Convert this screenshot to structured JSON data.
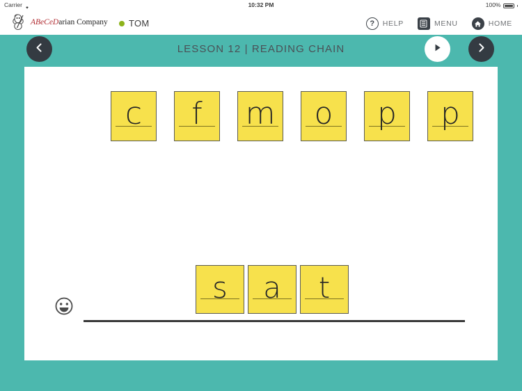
{
  "status_bar": {
    "carrier": "Carrier",
    "wifi_icon": "wifi-icon",
    "time": "10:32 PM",
    "battery_percent": "100%",
    "battery_icon": "battery-full-icon"
  },
  "header": {
    "logo_icon": "abecedarian-logo-icon",
    "brand_red": "ABeCeD",
    "brand_black": "arian Company",
    "user_name": "TOM",
    "user_status_color": "#8DB31B",
    "actions": [
      {
        "label": "HELP",
        "icon": "question-mark-icon"
      },
      {
        "label": "MENU",
        "icon": "menu-list-icon"
      },
      {
        "label": "HOME",
        "icon": "home-icon"
      }
    ]
  },
  "lesson_bar": {
    "title": "LESSON 12 | READING CHAIN",
    "prev_icon": "chevron-left-icon",
    "play_icon": "play-icon",
    "next_icon": "chevron-right-icon",
    "background_color": "#4CB8AE"
  },
  "activity": {
    "tile_color": "#F7E14C",
    "tile_border_color": "#5b5b52",
    "top_row": [
      "c",
      "f",
      "m",
      "o",
      "p",
      "p"
    ],
    "bottom_row": [
      "s",
      "a",
      "t"
    ],
    "smiley_icon": "smiley-face-icon",
    "writing_line": "writing-line"
  }
}
